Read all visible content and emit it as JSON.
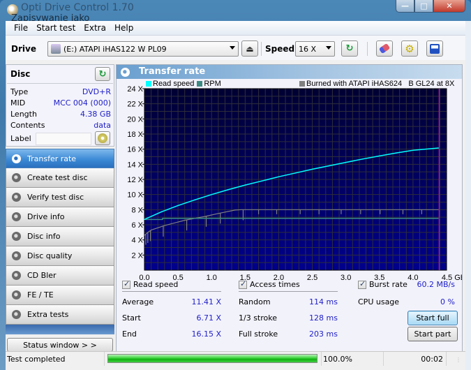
{
  "window": {
    "title": "Opti Drive Control 1.70",
    "ghost_title": "Zapisywanie jako",
    "buttons": {
      "minimize": "‗",
      "maximize": "▫",
      "close": "x"
    }
  },
  "menu": [
    "File",
    "Start test",
    "Extra",
    "Help"
  ],
  "toolbar": {
    "drive_label": "Drive",
    "drive_value": "(E:)   ATAPI iHAS122   W PL09",
    "speed_label": "Speed",
    "speed_value": "16 X",
    "icons": [
      "eject-icon",
      "refresh-icon",
      "erase-icon",
      "settings-icon",
      "save-icon"
    ]
  },
  "disc": {
    "title": "Disc",
    "fields": [
      {
        "label": "Type",
        "value": "DVD+R"
      },
      {
        "label": "MID",
        "value": "MCC 004 (000)"
      },
      {
        "label": "Length",
        "value": "4.38 GB"
      },
      {
        "label": "Contents",
        "value": "data"
      }
    ],
    "label_field": {
      "label": "Label",
      "value": ""
    }
  },
  "nav": {
    "items": [
      {
        "label": "Transfer rate",
        "active": true
      },
      {
        "label": "Create test disc",
        "active": false
      },
      {
        "label": "Verify test disc",
        "active": false
      },
      {
        "label": "Drive info",
        "active": false
      },
      {
        "label": "Disc info",
        "active": false
      },
      {
        "label": "Disc quality",
        "active": false
      },
      {
        "label": "CD Bler",
        "active": false
      },
      {
        "label": "FE / TE",
        "active": false
      },
      {
        "label": "Extra tests",
        "active": false
      }
    ],
    "status_window_label": "Status window > >"
  },
  "panel": {
    "title": "Transfer rate"
  },
  "chart_data": {
    "type": "line",
    "title": "Transfer rate",
    "legend": [
      {
        "name": "Read speed",
        "color": "#00ffff"
      },
      {
        "name": "RPM",
        "color": "#3c8a82"
      },
      {
        "name": "Burned with ATAPI iHAS624   B GL24 at 8X",
        "color": "#808080"
      }
    ],
    "legend_placement": "top",
    "xlabel": "GB",
    "ylabel": "X",
    "xlim": [
      0,
      4.5
    ],
    "ylim": [
      0,
      24
    ],
    "x_ticks": [
      "0.0",
      "0.5",
      "1.0",
      "1.5",
      "2.0",
      "2.5",
      "3.0",
      "3.5",
      "4.0",
      "4.5 GB"
    ],
    "y_ticks": [
      "2 X",
      "4 X",
      "6 X",
      "8 X",
      "10 X",
      "12 X",
      "14 X",
      "16 X",
      "18 X",
      "20 X",
      "22 X",
      "24 X"
    ],
    "grid": true,
    "disc_end_marker_gb": 4.38,
    "series": [
      {
        "name": "Read speed",
        "color": "#00ffff",
        "x": [
          0.0,
          0.25,
          0.5,
          0.75,
          1.0,
          1.25,
          1.5,
          1.75,
          2.0,
          2.25,
          2.5,
          2.75,
          3.0,
          3.25,
          3.5,
          3.75,
          4.0,
          4.25,
          4.38
        ],
        "y": [
          6.71,
          7.7,
          8.55,
          9.3,
          10.0,
          10.65,
          11.25,
          11.8,
          12.35,
          12.85,
          13.35,
          13.8,
          14.25,
          14.7,
          15.1,
          15.5,
          15.85,
          16.05,
          16.15
        ]
      },
      {
        "name": "RPM",
        "color": "#3c8a82",
        "x": [
          0.0,
          0.27,
          0.27,
          4.38
        ],
        "y": [
          6.7,
          6.7,
          6.85,
          6.85
        ]
      },
      {
        "name": "Burned (write speed)",
        "color": "#808080",
        "x": [
          0.0,
          0.05,
          0.1,
          0.3,
          0.6,
          0.9,
          1.1,
          1.35,
          1.45,
          4.38
        ],
        "y": [
          4.6,
          5.0,
          5.3,
          5.9,
          6.6,
          7.1,
          7.5,
          7.95,
          8.0,
          8.0
        ],
        "dips_gb": [
          0.02,
          0.05,
          0.09,
          0.28,
          0.63,
          0.92,
          1.13,
          1.47,
          1.7,
          1.97,
          2.32,
          2.6,
          2.93,
          3.22,
          3.51,
          3.85,
          4.13
        ]
      }
    ]
  },
  "stats": {
    "read_speed": {
      "label": "Read speed",
      "checked": true,
      "rows": [
        {
          "label": "Average",
          "value": "11.41 X"
        },
        {
          "label": "Start",
          "value": "6.71 X"
        },
        {
          "label": "End",
          "value": "16.15 X"
        }
      ]
    },
    "access_times": {
      "label": "Access times",
      "checked": true,
      "rows": [
        {
          "label": "Random",
          "value": "114 ms"
        },
        {
          "label": "1/3 stroke",
          "value": "128 ms"
        },
        {
          "label": "Full stroke",
          "value": "203 ms"
        }
      ]
    },
    "burst_rate": {
      "label": "Burst rate",
      "checked": true,
      "value": "60.2 MB/s"
    },
    "cpu_usage": {
      "label": "CPU usage",
      "value": "0 %"
    },
    "start_full_label": "Start full",
    "start_part_label": "Start part"
  },
  "statusbar": {
    "message": "Test completed",
    "progress_percent": 100.0,
    "progress_text": "100.0%",
    "elapsed": "00:02"
  }
}
